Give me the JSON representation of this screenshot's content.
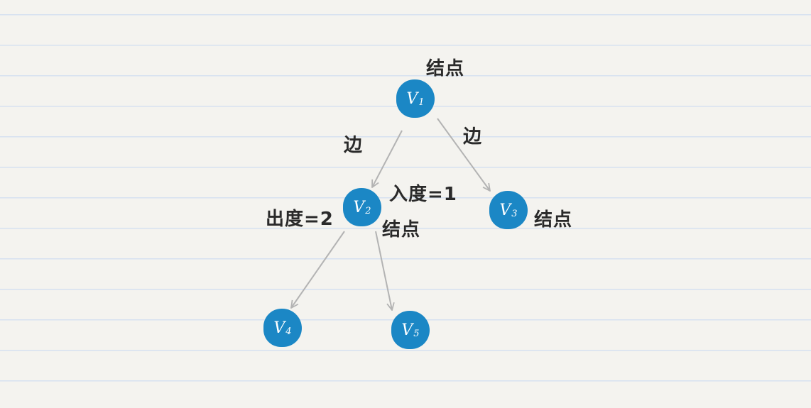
{
  "nodes": {
    "v1": {
      "letter": "V",
      "sub": "1"
    },
    "v2": {
      "letter": "V",
      "sub": "2"
    },
    "v3": {
      "letter": "V",
      "sub": "3"
    },
    "v4": {
      "letter": "V",
      "sub": "4"
    },
    "v5": {
      "letter": "V",
      "sub": "5"
    }
  },
  "annotations": {
    "node_label_v1": "结点",
    "edge_label_left": "边",
    "edge_label_right": "边",
    "in_degree_v2": "入度=1",
    "out_degree_v2": "出度=2",
    "node_label_v2": "结点",
    "node_label_v3": "结点"
  },
  "colors": {
    "node_fill": "#1b87c5",
    "edge": "#b3b3b3",
    "paper": "#f4f3ef",
    "rule_line": "#d6e1f0"
  }
}
